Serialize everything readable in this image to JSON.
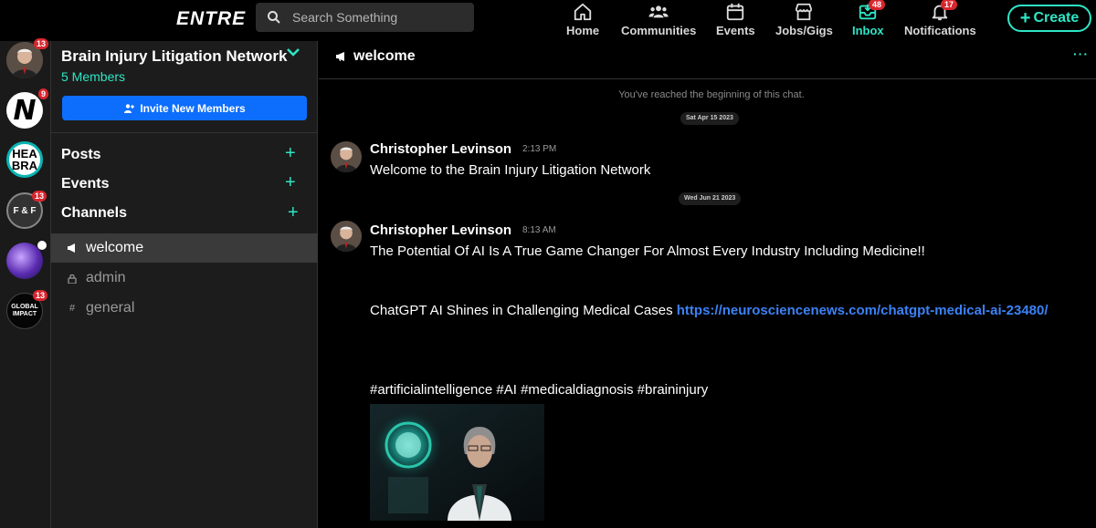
{
  "app": {
    "logo": "ENTRE"
  },
  "search": {
    "placeholder": "Search Something"
  },
  "nav": {
    "home": "Home",
    "communities": "Communities",
    "events": "Events",
    "jobs": "Jobs/Gigs",
    "inbox": "Inbox",
    "inbox_badge": "48",
    "notifications": "Notifications",
    "notifications_badge": "17",
    "create": "Create"
  },
  "rail": [
    {
      "name": "community-avatar-brain-injury",
      "badge": "13"
    },
    {
      "name": "community-n",
      "badge": "9",
      "text": "N"
    },
    {
      "name": "community-hea-bra",
      "text1": "HEA",
      "text2": "BRA"
    },
    {
      "name": "community-f-and-f",
      "badge": "13",
      "text": "F & F"
    },
    {
      "name": "community-galaxy",
      "dot": true
    },
    {
      "name": "community-global-impact",
      "badge": "13",
      "text1": "GLOBAL",
      "text2": "IMPACT"
    }
  ],
  "sidebar": {
    "title": "Brain Injury Litigation Network",
    "members": "5 Members",
    "invite": "Invite New Members",
    "sections": {
      "posts": "Posts",
      "events": "Events",
      "channels": "Channels"
    },
    "channels": [
      {
        "label": "welcome",
        "icon": "megaphone",
        "active": true
      },
      {
        "label": "admin",
        "icon": "lock",
        "active": false
      },
      {
        "label": "general",
        "icon": "#",
        "active": false
      }
    ]
  },
  "chat": {
    "title": "welcome",
    "beginning": "You've reached the beginning of this chat.",
    "date1": "Sat Apr 15 2023",
    "date2": "Wed Jun 21 2023",
    "messages": [
      {
        "author": "Christopher Levinson",
        "time": "2:13 PM",
        "text": "Welcome to the Brain Injury Litigation Network"
      },
      {
        "author": "Christopher Levinson",
        "time": "8:13 AM",
        "line1": "The Potential Of AI Is A True Game Changer For Almost Every Industry Including Medicine!!",
        "line2": "ChatGPT AI Shines in Challenging Medical Cases ",
        "link": "https://neurosciencenews.com/chatgpt-medical-ai-23480/",
        "line3": "#artificialintelligence #AI #medicaldiagnosis #braininjury"
      }
    ]
  },
  "colors": {
    "accent": "#2ee6c5",
    "primary": "#0d6efd",
    "badge": "#d9262e",
    "link": "#3b82f6"
  }
}
